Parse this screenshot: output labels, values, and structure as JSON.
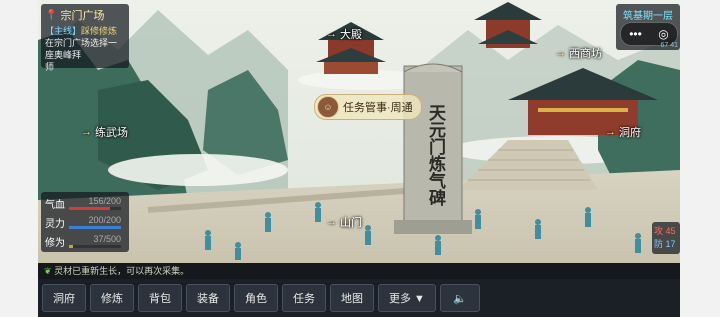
{
  "location": {
    "name": "宗门广场",
    "pin_icon": "map-pin-icon"
  },
  "quest": {
    "tag": "【主线】",
    "task": "踩修修炼",
    "desc": "在宗门广场选择一座奥峰拜",
    "desc2": "师"
  },
  "hotspots": {
    "main_hall": "大殿",
    "west_shop": "西商坊",
    "training": "练武场",
    "cave": "洞府",
    "gate": "山门"
  },
  "npc": {
    "label": "任务管事·周通"
  },
  "stele": {
    "title": "天元门炼气碑"
  },
  "stats": [
    {
      "label": "气血",
      "value": "156/200",
      "fraction": 0.78,
      "color": "#d63b3b"
    },
    {
      "label": "灵力",
      "value": "200/200",
      "fraction": 1.0,
      "color": "#3b7ed6"
    },
    {
      "label": "修为",
      "value": "37/500",
      "fraction": 0.074,
      "color": "#c8a23b"
    }
  ],
  "realm": {
    "label": "筑基期一层",
    "extra": "67 41"
  },
  "combat": {
    "atk_label": "攻",
    "atk": "45",
    "def_label": "防",
    "def": "17"
  },
  "log": {
    "message": "灵材已重新生长，可以再次采集。"
  },
  "buttons": [
    "洞府",
    "修炼",
    "背包",
    "装备",
    "角色",
    "任务",
    "地图",
    "更多 ▼"
  ],
  "sound_icon": "speaker-icon",
  "colors": {
    "accent_gold": "#ffe7a8",
    "cyan": "#7ee8ff"
  }
}
